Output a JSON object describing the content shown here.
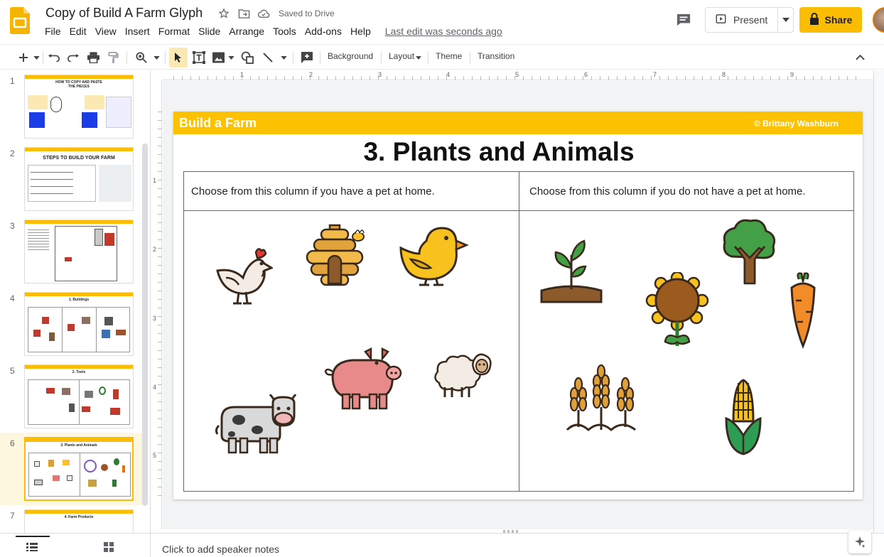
{
  "app": {
    "title": "Copy of Build A Farm Glyph",
    "saved_status": "Saved to Drive",
    "last_edit": "Last edit was seconds ago",
    "menu": [
      "File",
      "Edit",
      "View",
      "Insert",
      "Format",
      "Slide",
      "Arrange",
      "Tools",
      "Add-ons",
      "Help"
    ],
    "present_label": "Present",
    "share_label": "Share",
    "brand_color": "#fbbc04"
  },
  "toolbar": {
    "background_label": "Background",
    "layout_label": "Layout",
    "theme_label": "Theme",
    "transition_label": "Transition"
  },
  "ruler": {
    "h": [
      "1",
      "2",
      "3",
      "4",
      "5",
      "6",
      "7",
      "8",
      "9"
    ],
    "v": [
      "1",
      "2",
      "3",
      "4",
      "5"
    ]
  },
  "filmstrip": {
    "active_index": 6,
    "slides": [
      {
        "number": "1",
        "title": "HOW TO COPY AND PASTE THE PIECES"
      },
      {
        "number": "2",
        "title": "STEPS TO BUILD YOUR FARM"
      },
      {
        "number": "3",
        "title": ""
      },
      {
        "number": "4",
        "title": "1. Buildings"
      },
      {
        "number": "5",
        "title": "2. Tools"
      },
      {
        "number": "6",
        "title": "3. Plants and Animals"
      },
      {
        "number": "7",
        "title": "4. Farm Products"
      }
    ]
  },
  "slide": {
    "banner_left": "Build a Farm",
    "banner_right": "© Brittany Washburn",
    "title": "3. Plants and Animals",
    "left_header": "Choose from this column if you have a pet at home.",
    "right_header": "Choose from this column if you do not have a pet at home.",
    "banner_color": "#fcc200"
  },
  "notes": {
    "placeholder": "Click to add speaker notes"
  }
}
